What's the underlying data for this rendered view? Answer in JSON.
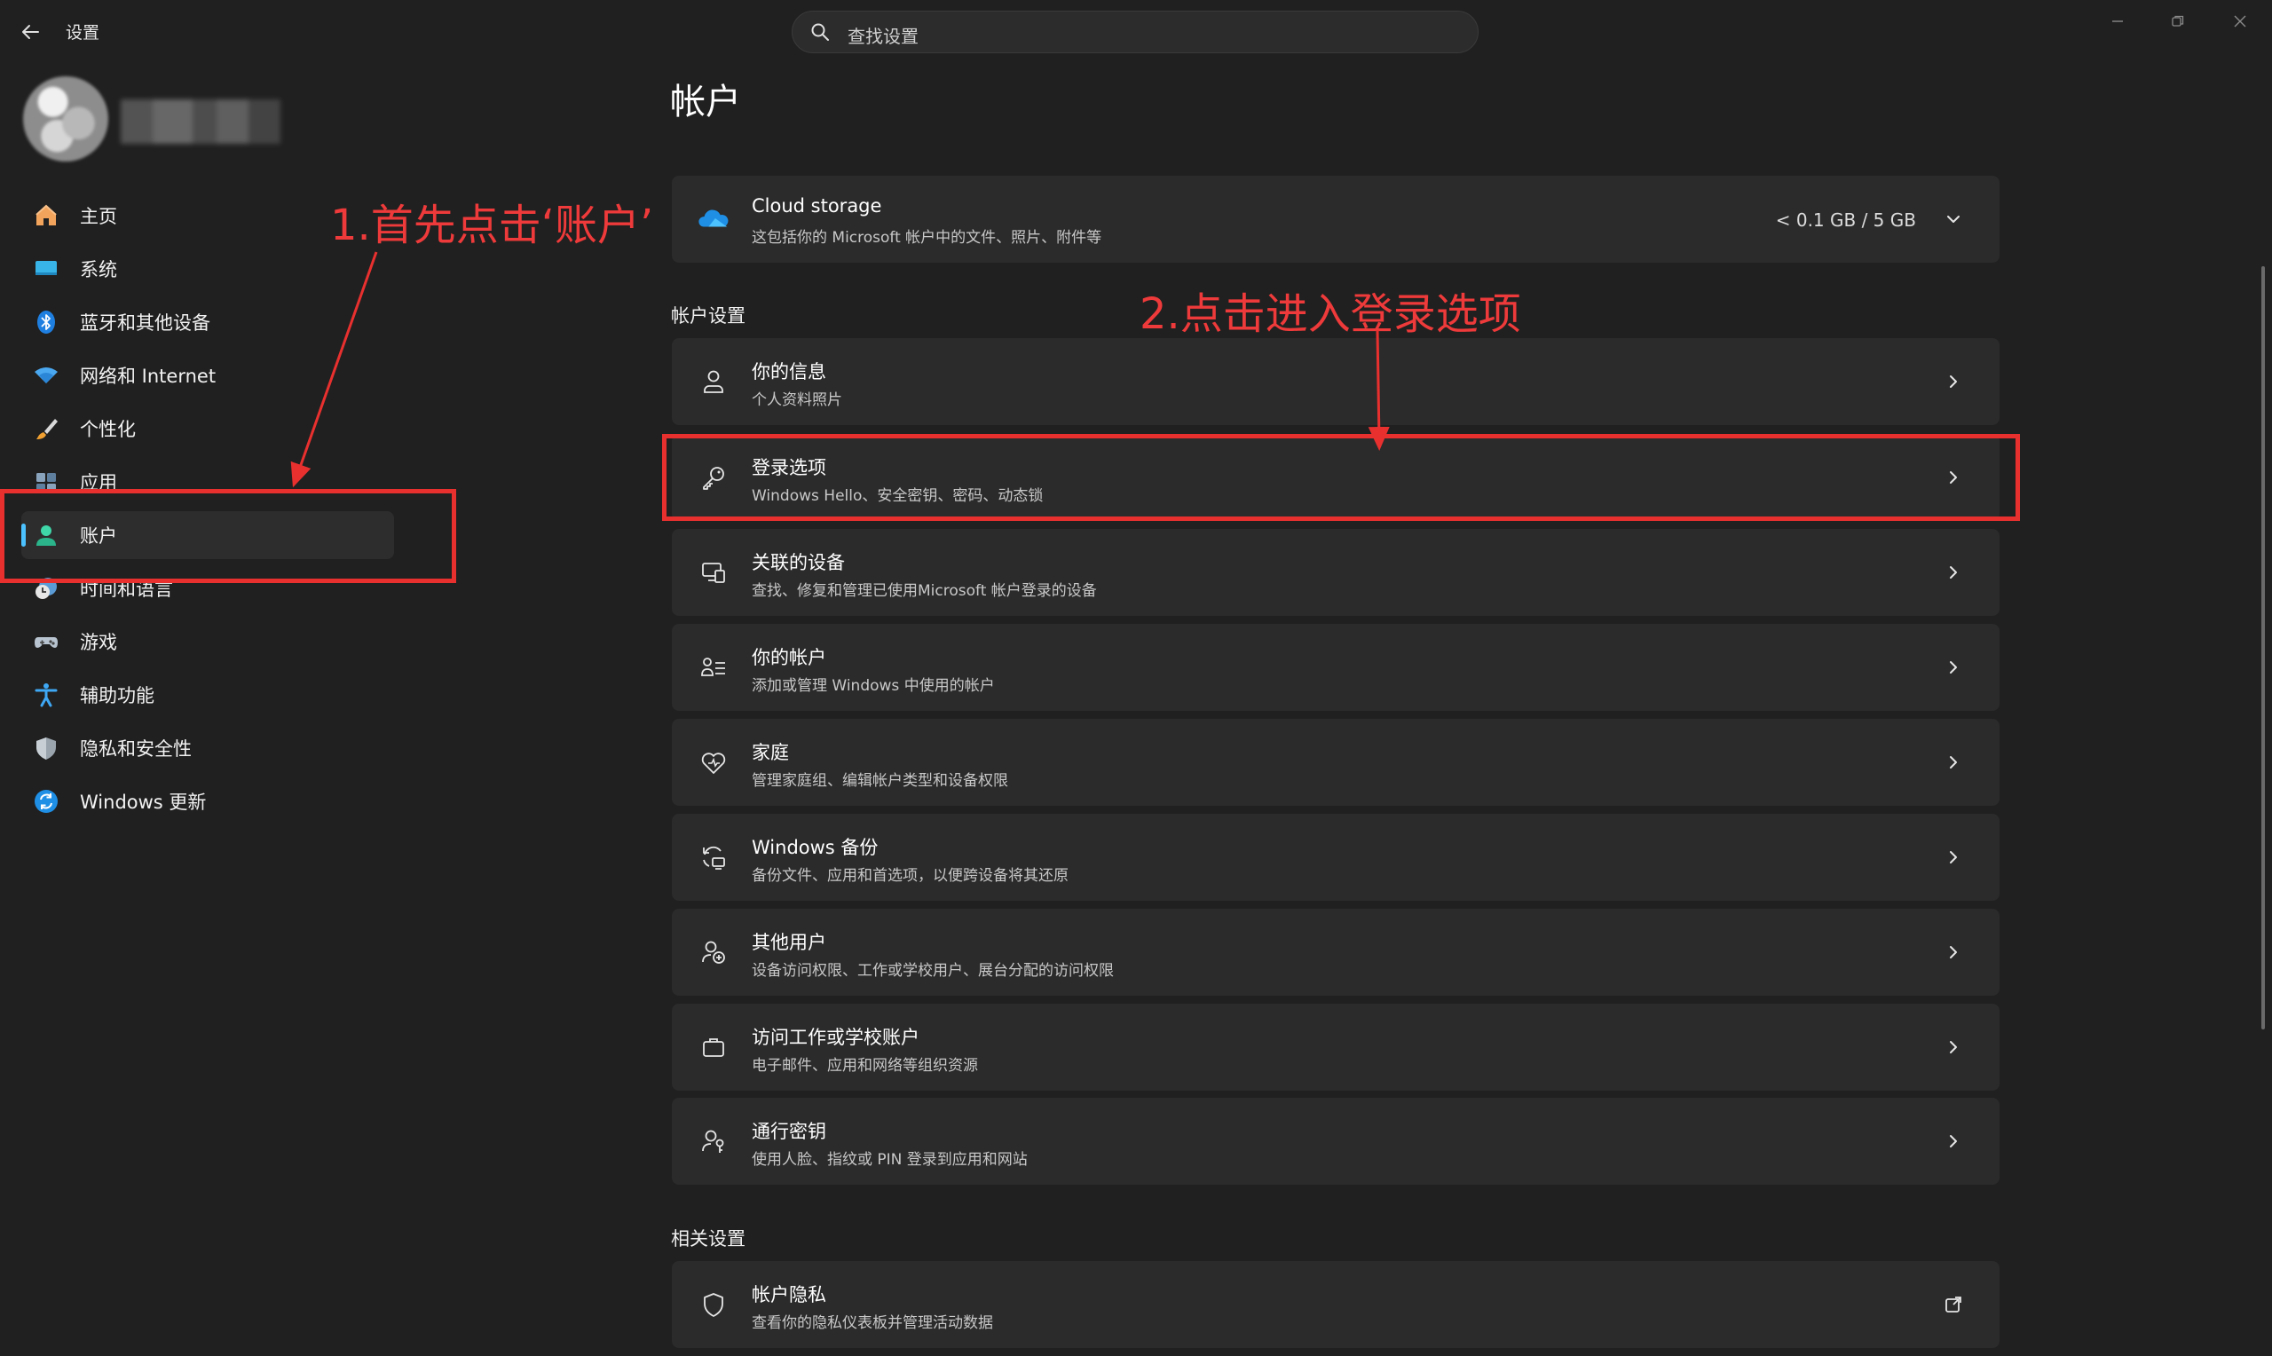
{
  "window": {
    "app_title": "设置",
    "search_placeholder": "查找设置"
  },
  "page": {
    "title": "帐户"
  },
  "sidebar": {
    "items": [
      {
        "label": "主页",
        "icon": "home-icon"
      },
      {
        "label": "系统",
        "icon": "monitor-icon"
      },
      {
        "label": "蓝牙和其他设备",
        "icon": "bluetooth-icon"
      },
      {
        "label": "网络和 Internet",
        "icon": "wifi-icon"
      },
      {
        "label": "个性化",
        "icon": "brush-icon"
      },
      {
        "label": "应用",
        "icon": "apps-icon"
      },
      {
        "label": "账户",
        "icon": "account-icon",
        "selected": true
      },
      {
        "label": "时间和语言",
        "icon": "clock-globe-icon"
      },
      {
        "label": "游戏",
        "icon": "gamepad-icon"
      },
      {
        "label": "辅助功能",
        "icon": "accessibility-icon"
      },
      {
        "label": "隐私和安全性",
        "icon": "shield-icon"
      },
      {
        "label": "Windows 更新",
        "icon": "update-icon"
      }
    ]
  },
  "cloud": {
    "title": "Cloud storage",
    "subtitle": "这包括你的 Microsoft 帐户中的文件、照片、附件等",
    "usage": "< 0.1 GB / 5 GB"
  },
  "sections": {
    "account_settings": "帐户设置",
    "related_settings": "相关设置"
  },
  "cards": [
    {
      "title": "你的信息",
      "subtitle": "个人资料照片",
      "icon": "person-icon"
    },
    {
      "title": "登录选项",
      "subtitle": "Windows Hello、安全密钥、密码、动态锁",
      "icon": "key-icon"
    },
    {
      "title": "关联的设备",
      "subtitle": "查找、修复和管理已使用Microsoft 帐户登录的设备",
      "icon": "devices-icon"
    },
    {
      "title": "你的帐户",
      "subtitle": "添加或管理 Windows 中使用的帐户",
      "icon": "people-list-icon"
    },
    {
      "title": "家庭",
      "subtitle": "管理家庭组、编辑帐户类型和设备权限",
      "icon": "family-heart-icon"
    },
    {
      "title": "Windows 备份",
      "subtitle": "备份文件、应用和首选项，以便跨设备将其还原",
      "icon": "backup-icon"
    },
    {
      "title": "其他用户",
      "subtitle": "设备访问权限、工作或学校用户、展台分配的访问权限",
      "icon": "add-user-icon"
    },
    {
      "title": "访问工作或学校账户",
      "subtitle": "电子邮件、应用和网络等组织资源",
      "icon": "briefcase-icon"
    },
    {
      "title": "通行密钥",
      "subtitle": "使用人脸、指纹或 PIN 登录到应用和网站",
      "icon": "passkey-icon"
    }
  ],
  "related_cards": [
    {
      "title": "帐户隐私",
      "subtitle": "查看你的隐私仪表板并管理活动数据",
      "icon": "shield-outline-icon"
    }
  ],
  "annotations": {
    "step1": "1.首先点击‘账户’",
    "step2": "2.点击进入登录选项"
  },
  "colors": {
    "accent": "#4cc2ff",
    "annotation": "#e8302f",
    "background": "#202020",
    "card": "#2b2b2b"
  }
}
